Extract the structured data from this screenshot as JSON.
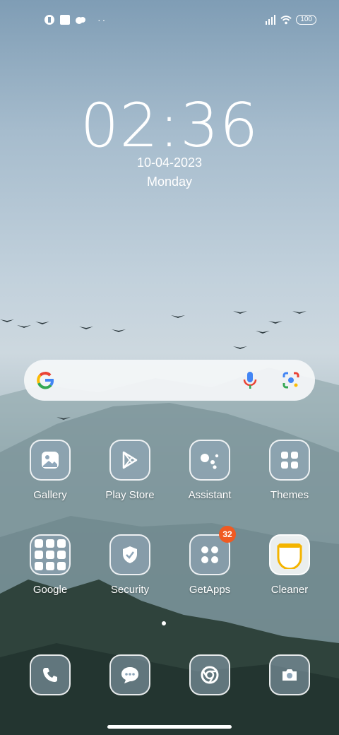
{
  "status": {
    "left_icons": [
      "notification-icon",
      "square-icon",
      "cloud-icon"
    ],
    "dots": "··",
    "battery": "100"
  },
  "lock": {
    "time": "02:36",
    "date": "10-04-2023",
    "day": "Monday"
  },
  "search": {
    "icons": [
      "google-g-icon",
      "microphone-icon",
      "lens-camera-icon"
    ]
  },
  "apps": [
    {
      "label": "Gallery"
    },
    {
      "label": "Play Store"
    },
    {
      "label": "Assistant"
    },
    {
      "label": "Themes"
    },
    {
      "label": "Google"
    },
    {
      "label": "Security"
    },
    {
      "label": "GetApps",
      "badge": "32"
    },
    {
      "label": "Cleaner"
    }
  ],
  "dock": [
    "phone-icon",
    "messages-icon",
    "chrome-icon",
    "camera-icon"
  ],
  "colors": {
    "badge": "#f05a22",
    "google_blue": "#4285f4",
    "google_red": "#ea4335",
    "google_yellow": "#fbbc05",
    "google_green": "#34a853"
  }
}
